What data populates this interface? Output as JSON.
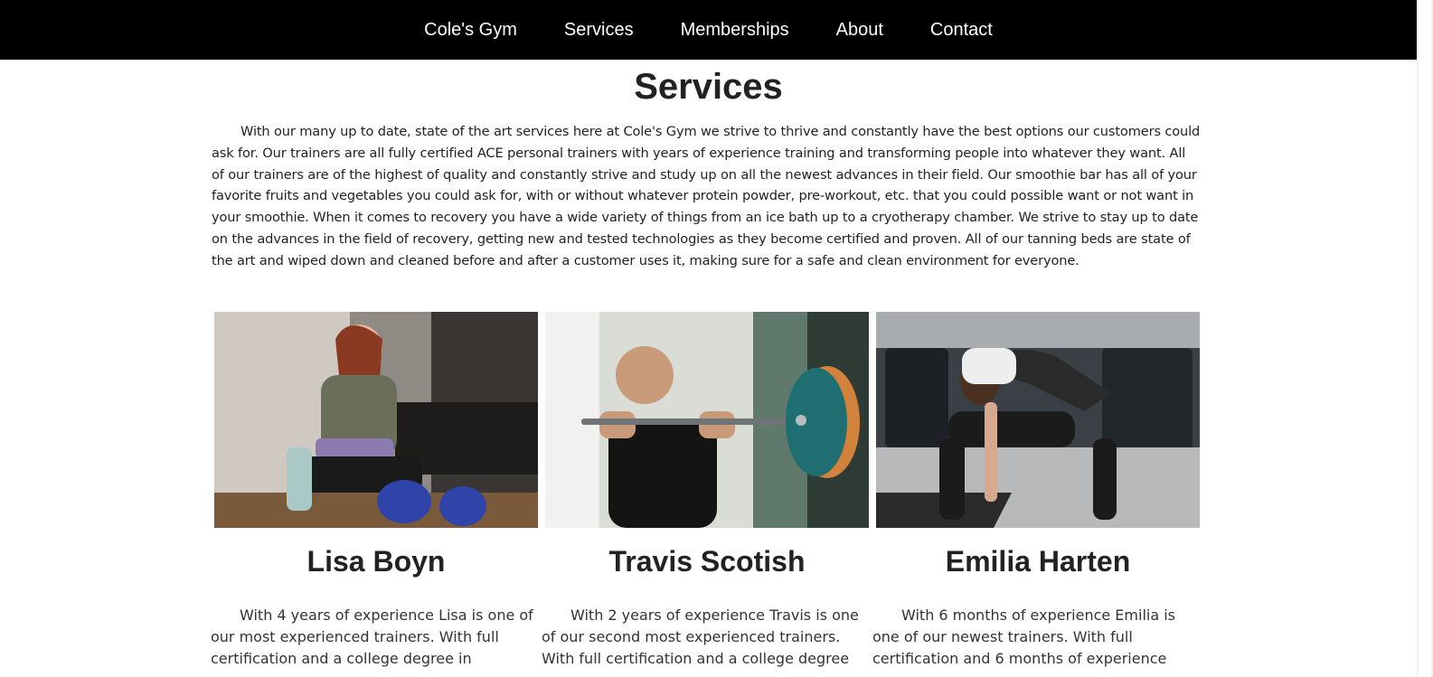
{
  "nav": {
    "items": [
      {
        "label": "Cole's Gym"
      },
      {
        "label": "Services"
      },
      {
        "label": "Memberships"
      },
      {
        "label": "About"
      },
      {
        "label": "Contact"
      }
    ]
  },
  "page": {
    "title": "Services",
    "intro": "With our many up to date, state of the art services here at Cole's Gym we strive to thrive and constantly have the best options our customers could ask for. Our trainers are all fully certified ACE personal trainers with years of experience training and transforming people into whatever they want. All of our trainers are of the highest of quality and constantly strive and study up on all the newest advances in their field. Our smoothie bar has all of your favorite fruits and vegetables you could ask for, with or without whatever protein powder, pre-workout, etc. that you could possible want or not want in your smoothie. When it comes to recovery you have a wide variety of things from an ice bath up to a cryotherapy chamber. We strive to stay up to date on the advances in the field of recovery, getting new and tested technologies as they become certified and proven. All of our tanning beds are state of the art and wiped down and cleaned before and after a customer uses it, making sure for a safe and clean environment for everyone."
  },
  "trainers": [
    {
      "name": "Lisa Boyn",
      "bio": "With 4 years of experience Lisa is one of our most experienced trainers. With full certification and a college degree in"
    },
    {
      "name": "Travis Scotish",
      "bio": "With 2 years of experience Travis is one of our second most experienced trainers. With full certification and a college degree"
    },
    {
      "name": "Emilia Harten",
      "bio": "With 6 months of experience Emilia is one of our newest trainers. With full certification and 6 months of experience"
    }
  ],
  "colors": {
    "nav_bg": "#000000",
    "nav_text": "#ffffff",
    "page_bg": "#ffffff",
    "text": "#222222"
  }
}
